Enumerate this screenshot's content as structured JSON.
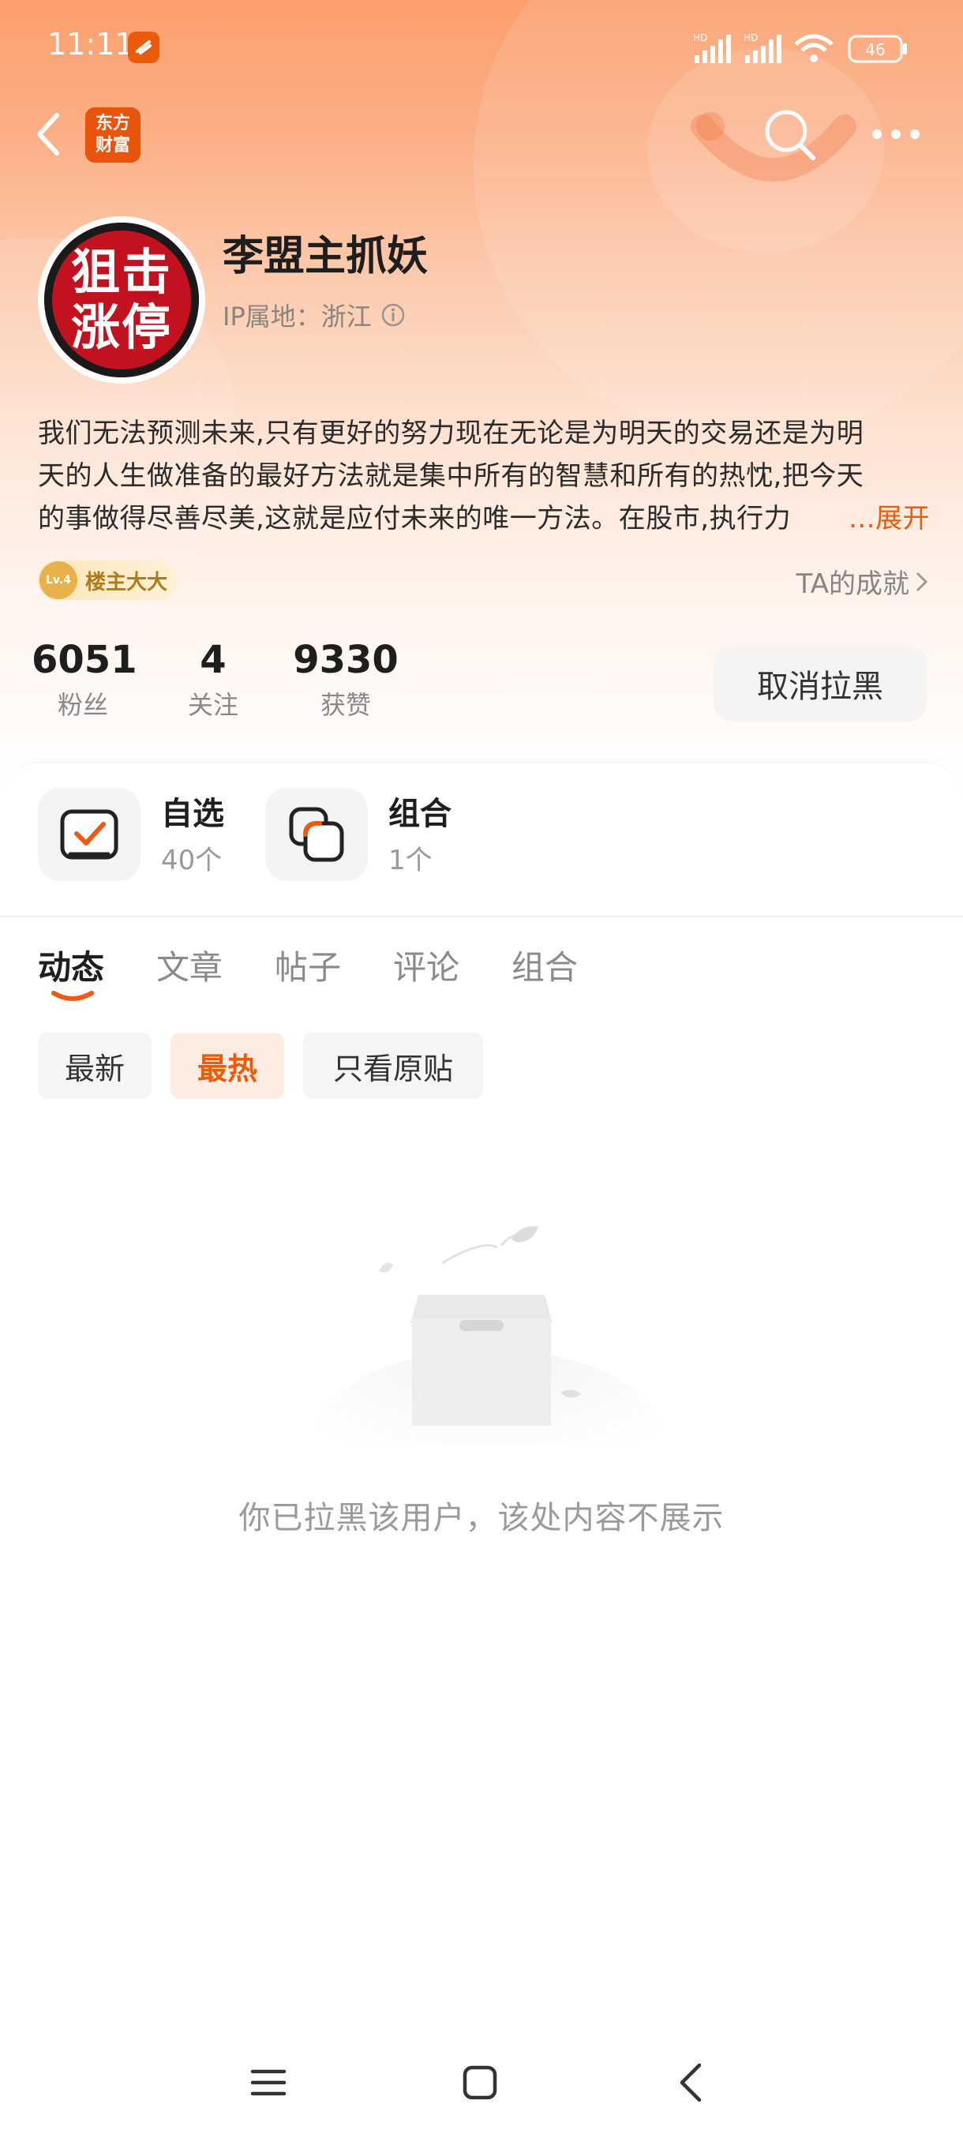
{
  "status_bar": {
    "time": "11:11",
    "battery": "46",
    "network1": "HD",
    "network2": "HD"
  },
  "header": {
    "app_logo_line1": "东方",
    "app_logo_line2": "财富"
  },
  "profile": {
    "avatar_line1": "狙击",
    "avatar_line2": "涨停",
    "nickname": "李盟主抓妖",
    "ip_location": "IP属地：浙江",
    "bio_line1": "我们无法预测未来,只有更好的努力现在无论是为明天的交易还是为明",
    "bio_line2": "天的人生做准备的最好方法就是集中所有的智慧和所有的热忱,把今天",
    "bio_line3": "的事做得尽善尽美,这就是应付未来的唯一方法。在股市,执行力",
    "expand_label": "...展开",
    "badge_level": "Lv.4",
    "badge_label": "楼主大大",
    "achievements_link": "TA的成就"
  },
  "stats": [
    {
      "value": "6051",
      "label": "粉丝"
    },
    {
      "value": "4",
      "label": "关注"
    },
    {
      "value": "9330",
      "label": "获赞"
    }
  ],
  "unblock_button": "取消拉黑",
  "tools": [
    {
      "title": "自选",
      "count": "40个",
      "icon": "watchlist-check-icon"
    },
    {
      "title": "组合",
      "count": "1个",
      "icon": "portfolio-icon"
    }
  ],
  "tabs": [
    "动态",
    "文章",
    "帖子",
    "评论",
    "组合"
  ],
  "active_tab": 0,
  "filters": [
    "最新",
    "最热",
    "只看原贴"
  ],
  "active_filter": 1,
  "empty_state": {
    "message": "你已拉黑该用户，该处内容不展示",
    "icon": "empty-box-icon"
  },
  "colors": {
    "accent": "#ea5b0c",
    "header_gradient_top": "#fb9f6c"
  }
}
